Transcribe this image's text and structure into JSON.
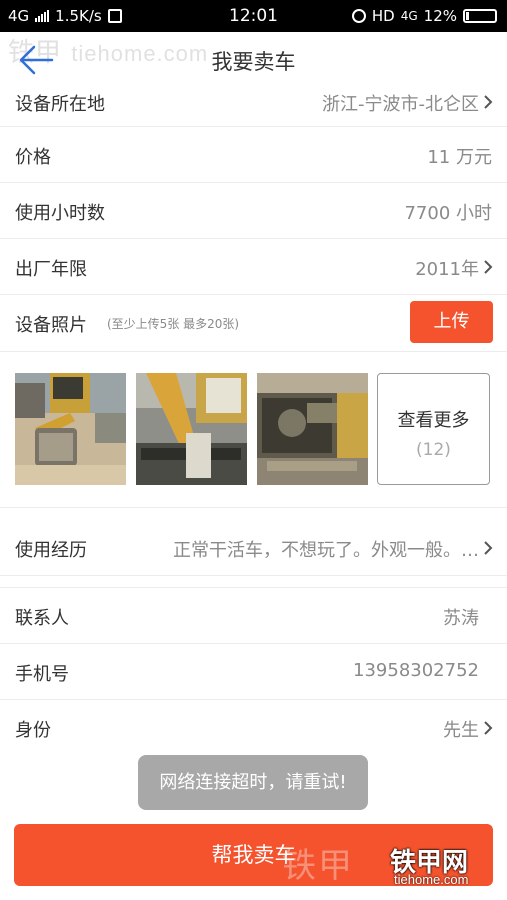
{
  "statusbar": {
    "network": "4G",
    "speed": "1.5K/s",
    "time": "12:01",
    "hd": "HD",
    "network2": "4G",
    "battery": "12%",
    "battery_level": 0.12
  },
  "header": {
    "title": "我要卖车",
    "watermark": "铁甲",
    "watermark_site": "tiehome.com"
  },
  "rows": {
    "location": {
      "label": "设备所在地",
      "value": "浙江-宁波市-北仑区"
    },
    "price": {
      "label": "价格",
      "value": "11 万元"
    },
    "hours": {
      "label": "使用小时数",
      "value": "7700 小时"
    },
    "year": {
      "label": "出厂年限",
      "value": "2011年"
    },
    "photos": {
      "label": "设备照片",
      "hint": "(至少上传5张 最多20张)",
      "upload": "上传"
    },
    "experience": {
      "label": "使用经历",
      "value": "正常干活车，不想玩了。外观一般。…"
    },
    "contact": {
      "label": "联系人",
      "value": "苏涛"
    },
    "phone": {
      "label": "手机号",
      "value": "13958302752"
    },
    "identity": {
      "label": "身份",
      "value": "先生"
    }
  },
  "photos": {
    "more_label": "查看更多",
    "more_count": "(12)"
  },
  "toast": "网络连接超时，请重试!",
  "sell_button": "帮我卖车",
  "brand": {
    "watermark_bottom": "铁甲",
    "logo_cn": "铁甲网",
    "logo_en": "tiehome.com"
  },
  "colors": {
    "accent": "#f4532e",
    "back_arrow": "#2f6fd6"
  }
}
